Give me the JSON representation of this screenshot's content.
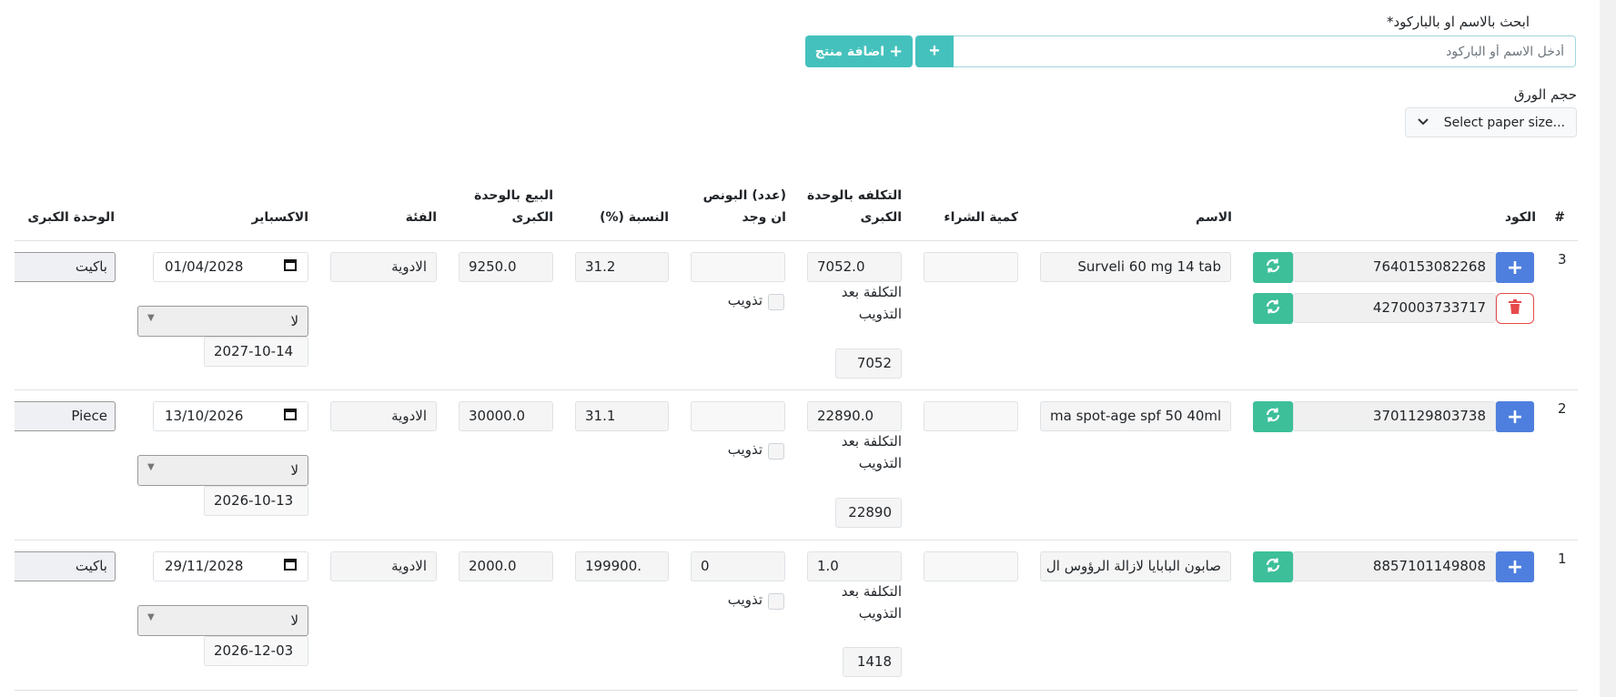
{
  "search": {
    "label": "ابحث بالاسم او بالباركود*",
    "placeholder": "أدخل الاسم أو الباركود",
    "plus_btn": "+",
    "add_product_label": "اضافة منتج",
    "add_product_icon": "+"
  },
  "paper": {
    "label": "حجم الورق",
    "placeholder": "Select paper size..."
  },
  "table": {
    "headers": {
      "num": "#",
      "code": "الكود",
      "name": "الاسم",
      "purchase_qty": "كمية الشراء",
      "cost_line1": "التكلفه بالوحدة",
      "cost_line2": "الكبرى",
      "bonus_line1": "(عدد) البونص",
      "bonus_line2": "ان وجد",
      "ratio": "النسبة (%)",
      "sale_line1": "البيع بالوحدة",
      "sale_line2": "الكبرى",
      "category": "الفئة",
      "expiry": "الاكسباير",
      "big_unit": "الوحدة الكبرى"
    },
    "cost_after_bonus_label1": "التكلفة بعد",
    "cost_after_bonus_label2": "التذويب",
    "bonus_check_label": "تذويب",
    "rows": [
      {
        "num": "3",
        "barcodes": [
          "7640153082268",
          "4270003733717"
        ],
        "name": "Surveli 60 mg 14 tab",
        "purchase_qty": "",
        "cost": "7052.0",
        "cost_after": "7052",
        "bonus": "",
        "ratio": "31.2",
        "sale": "9250.0",
        "category": "الادوية",
        "expiry": "01/04/2028",
        "select": "لا",
        "date2": "2027-10-14",
        "unit": "باكيت"
      },
      {
        "num": "2",
        "barcodes": [
          "3701129803738"
        ],
        "name": "ma spot-age spf 50 40ml",
        "purchase_qty": "",
        "cost": "22890.0",
        "cost_after": "22890",
        "bonus": "",
        "ratio": "31.1",
        "sale": "30000.0",
        "category": "الادوية",
        "expiry": "13/10/2026",
        "select": "لا",
        "date2": "2026-10-13",
        "unit": "Piece"
      },
      {
        "num": "1",
        "barcodes": [
          "8857101149808"
        ],
        "name": "صابون البابايا لازالة الرؤوس ال",
        "purchase_qty": "",
        "cost": "1.0",
        "cost_after": "1418",
        "bonus": "0",
        "ratio": "199900.",
        "sale": "2000.0",
        "category": "الادوية",
        "expiry": "29/11/2028",
        "select": "لا",
        "date2": "2026-12-03",
        "unit": "باكيت"
      }
    ]
  }
}
